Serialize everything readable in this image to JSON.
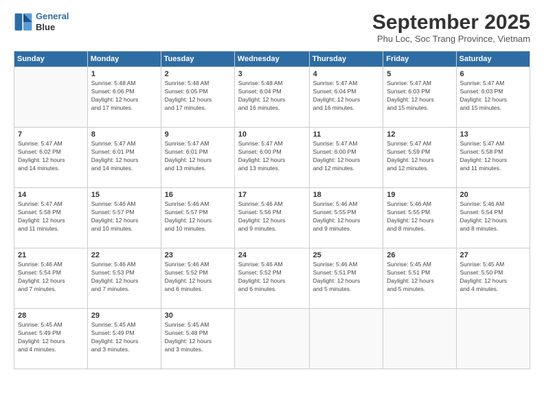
{
  "logo": {
    "line1": "General",
    "line2": "Blue"
  },
  "title": "September 2025",
  "subtitle": "Phu Loc, Soc Trang Province, Vietnam",
  "days_of_week": [
    "Sunday",
    "Monday",
    "Tuesday",
    "Wednesday",
    "Thursday",
    "Friday",
    "Saturday"
  ],
  "weeks": [
    [
      {
        "day": "",
        "info": ""
      },
      {
        "day": "1",
        "info": "Sunrise: 5:48 AM\nSunset: 6:06 PM\nDaylight: 12 hours\nand 17 minutes."
      },
      {
        "day": "2",
        "info": "Sunrise: 5:48 AM\nSunset: 6:05 PM\nDaylight: 12 hours\nand 17 minutes."
      },
      {
        "day": "3",
        "info": "Sunrise: 5:48 AM\nSunset: 6:04 PM\nDaylight: 12 hours\nand 16 minutes."
      },
      {
        "day": "4",
        "info": "Sunrise: 5:47 AM\nSunset: 6:04 PM\nDaylight: 12 hours\nand 16 minutes."
      },
      {
        "day": "5",
        "info": "Sunrise: 5:47 AM\nSunset: 6:03 PM\nDaylight: 12 hours\nand 15 minutes."
      },
      {
        "day": "6",
        "info": "Sunrise: 5:47 AM\nSunset: 6:03 PM\nDaylight: 12 hours\nand 15 minutes."
      }
    ],
    [
      {
        "day": "7",
        "info": "Sunrise: 5:47 AM\nSunset: 6:02 PM\nDaylight: 12 hours\nand 14 minutes."
      },
      {
        "day": "8",
        "info": "Sunrise: 5:47 AM\nSunset: 6:01 PM\nDaylight: 12 hours\nand 14 minutes."
      },
      {
        "day": "9",
        "info": "Sunrise: 5:47 AM\nSunset: 6:01 PM\nDaylight: 12 hours\nand 13 minutes."
      },
      {
        "day": "10",
        "info": "Sunrise: 5:47 AM\nSunset: 6:00 PM\nDaylight: 12 hours\nand 13 minutes."
      },
      {
        "day": "11",
        "info": "Sunrise: 5:47 AM\nSunset: 6:00 PM\nDaylight: 12 hours\nand 12 minutes."
      },
      {
        "day": "12",
        "info": "Sunrise: 5:47 AM\nSunset: 5:59 PM\nDaylight: 12 hours\nand 12 minutes."
      },
      {
        "day": "13",
        "info": "Sunrise: 5:47 AM\nSunset: 5:58 PM\nDaylight: 12 hours\nand 11 minutes."
      }
    ],
    [
      {
        "day": "14",
        "info": "Sunrise: 5:47 AM\nSunset: 5:58 PM\nDaylight: 12 hours\nand 11 minutes."
      },
      {
        "day": "15",
        "info": "Sunrise: 5:46 AM\nSunset: 5:57 PM\nDaylight: 12 hours\nand 10 minutes."
      },
      {
        "day": "16",
        "info": "Sunrise: 5:46 AM\nSunset: 5:57 PM\nDaylight: 12 hours\nand 10 minutes."
      },
      {
        "day": "17",
        "info": "Sunrise: 5:46 AM\nSunset: 5:56 PM\nDaylight: 12 hours\nand 9 minutes."
      },
      {
        "day": "18",
        "info": "Sunrise: 5:46 AM\nSunset: 5:55 PM\nDaylight: 12 hours\nand 9 minutes."
      },
      {
        "day": "19",
        "info": "Sunrise: 5:46 AM\nSunset: 5:55 PM\nDaylight: 12 hours\nand 8 minutes."
      },
      {
        "day": "20",
        "info": "Sunrise: 5:46 AM\nSunset: 5:54 PM\nDaylight: 12 hours\nand 8 minutes."
      }
    ],
    [
      {
        "day": "21",
        "info": "Sunrise: 5:46 AM\nSunset: 5:54 PM\nDaylight: 12 hours\nand 7 minutes."
      },
      {
        "day": "22",
        "info": "Sunrise: 5:46 AM\nSunset: 5:53 PM\nDaylight: 12 hours\nand 7 minutes."
      },
      {
        "day": "23",
        "info": "Sunrise: 5:46 AM\nSunset: 5:52 PM\nDaylight: 12 hours\nand 6 minutes."
      },
      {
        "day": "24",
        "info": "Sunrise: 5:46 AM\nSunset: 5:52 PM\nDaylight: 12 hours\nand 6 minutes."
      },
      {
        "day": "25",
        "info": "Sunrise: 5:46 AM\nSunset: 5:51 PM\nDaylight: 12 hours\nand 5 minutes."
      },
      {
        "day": "26",
        "info": "Sunrise: 5:45 AM\nSunset: 5:51 PM\nDaylight: 12 hours\nand 5 minutes."
      },
      {
        "day": "27",
        "info": "Sunrise: 5:45 AM\nSunset: 5:50 PM\nDaylight: 12 hours\nand 4 minutes."
      }
    ],
    [
      {
        "day": "28",
        "info": "Sunrise: 5:45 AM\nSunset: 5:49 PM\nDaylight: 12 hours\nand 4 minutes."
      },
      {
        "day": "29",
        "info": "Sunrise: 5:45 AM\nSunset: 5:49 PM\nDaylight: 12 hours\nand 3 minutes."
      },
      {
        "day": "30",
        "info": "Sunrise: 5:45 AM\nSunset: 5:48 PM\nDaylight: 12 hours\nand 3 minutes."
      },
      {
        "day": "",
        "info": ""
      },
      {
        "day": "",
        "info": ""
      },
      {
        "day": "",
        "info": ""
      },
      {
        "day": "",
        "info": ""
      }
    ]
  ]
}
